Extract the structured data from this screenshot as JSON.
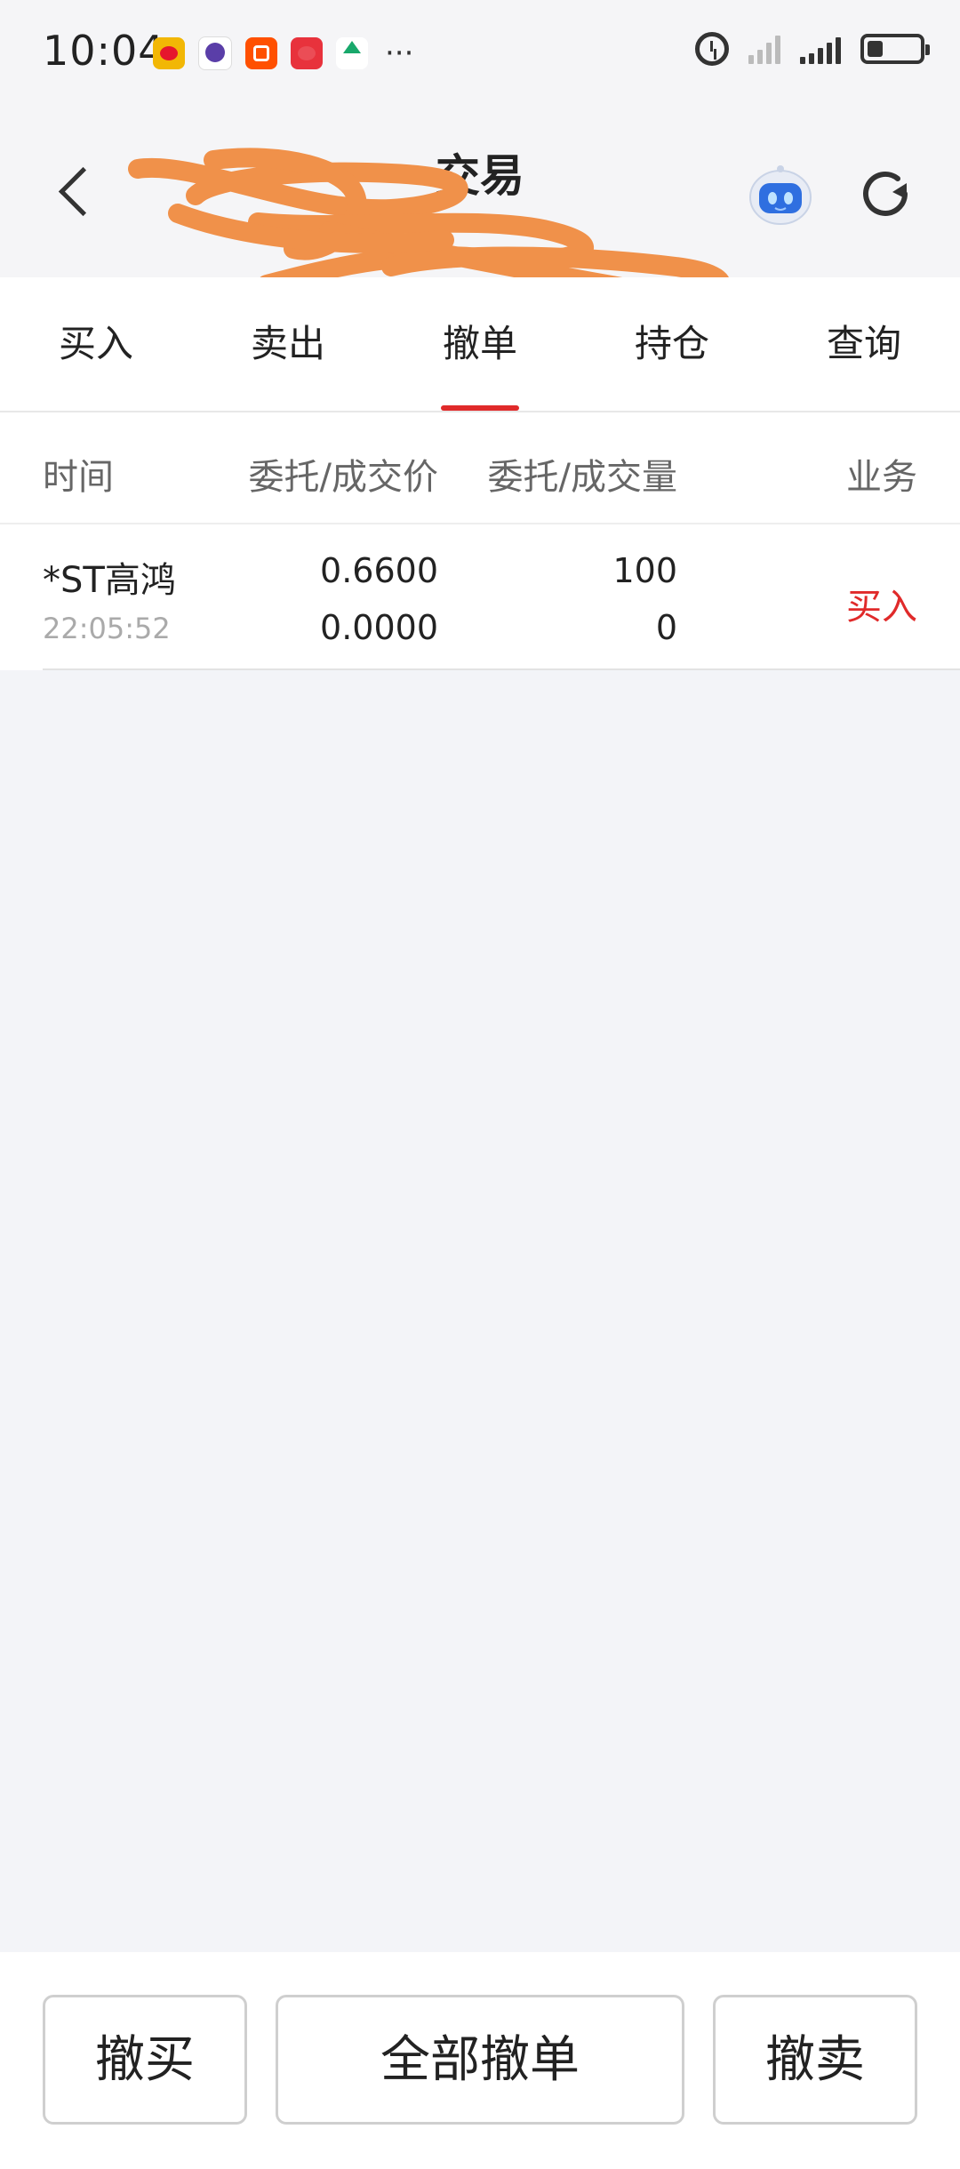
{
  "status_bar": {
    "time": "10:04",
    "notification_icons": [
      "weibo-icon",
      "game-icon",
      "taobao-icon",
      "lottery-icon",
      "home-app-icon"
    ],
    "more": "···",
    "battery_level": 0.3
  },
  "header": {
    "title": "交易",
    "back_icon": "chevron-left-icon",
    "assistant_icon": "robot-icon",
    "refresh_icon": "refresh-icon"
  },
  "tabs": [
    {
      "label": "买入",
      "active": false
    },
    {
      "label": "卖出",
      "active": false
    },
    {
      "label": "撤单",
      "active": true
    },
    {
      "label": "持仓",
      "active": false
    },
    {
      "label": "查询",
      "active": false
    }
  ],
  "table": {
    "headers": {
      "time": "时间",
      "price": "委托/成交价",
      "quantity": "委托/成交量",
      "business": "业务"
    },
    "rows": [
      {
        "name": "*ST高鸿",
        "time": "22:05:52",
        "order_price": "0.6600",
        "deal_price": "0.0000",
        "order_qty": "100",
        "deal_qty": "0",
        "business": "买入"
      }
    ]
  },
  "footer": {
    "cancel_buy": "撤买",
    "cancel_all": "全部撤单",
    "cancel_sell": "撤卖"
  },
  "colors": {
    "accent_red": "#e02a2a",
    "redaction_orange": "#f0914a"
  }
}
